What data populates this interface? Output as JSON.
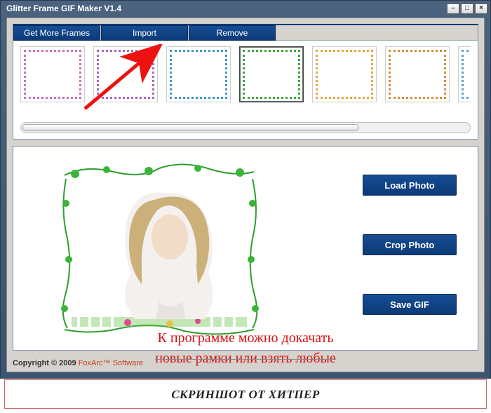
{
  "window": {
    "title": "Glitter Frame GIF Maker V1.4",
    "minimize": "–",
    "maximize": "□",
    "close": "×"
  },
  "toolbar": {
    "get_more": "Get More Frames",
    "import": "Import",
    "remove": "Remove"
  },
  "frames": [
    {
      "name": "frame-1",
      "selected": false,
      "border_color": "#c86fbf"
    },
    {
      "name": "frame-2",
      "selected": false,
      "border_color": "#a562c9"
    },
    {
      "name": "frame-3",
      "selected": false,
      "border_color": "#3a97c4"
    },
    {
      "name": "frame-4",
      "selected": true,
      "border_color": "#37a63a"
    },
    {
      "name": "frame-5",
      "selected": false,
      "border_color": "#e6a63a"
    },
    {
      "name": "frame-6",
      "selected": false,
      "border_color": "#d48e3a"
    },
    {
      "name": "frame-7",
      "selected": false,
      "border_color": "#5aa0d0"
    }
  ],
  "side_buttons": {
    "load": "Load Photo",
    "crop": "Crop Photo",
    "save": "Save GIF"
  },
  "footer": {
    "copyright": "Copyright © 2009 ",
    "link": "FoxArc™ Software"
  },
  "annotation": {
    "line1": "К программе можно докачать",
    "line2": "новые рамки или взять любые"
  },
  "watermark": "СКРИНШОТ ОТ ХИТПЕР"
}
